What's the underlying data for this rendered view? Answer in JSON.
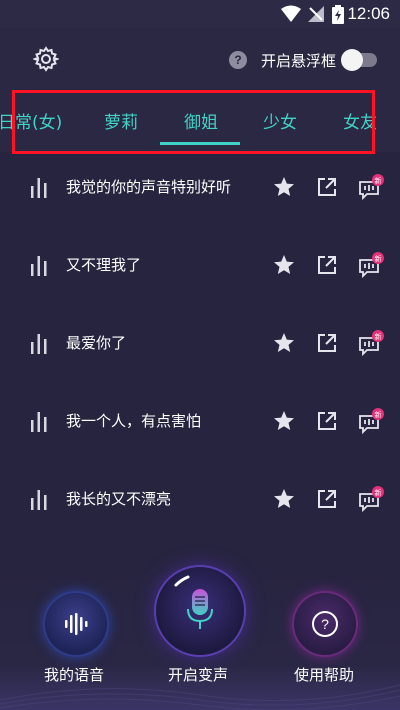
{
  "status_bar": {
    "time": "12:06"
  },
  "header": {
    "floating_window_label": "开启悬浮框",
    "floating_window_on": false
  },
  "tabs": {
    "items": [
      "日常(女)",
      "萝莉",
      "御姐",
      "少女",
      "女友"
    ],
    "selected": "御姐"
  },
  "list": {
    "items": [
      {
        "label": "我觉的你的声音特别好听",
        "badge": "新"
      },
      {
        "label": "又不理我了",
        "badge": "新"
      },
      {
        "label": "最爱你了",
        "badge": "新"
      },
      {
        "label": "我一个人，有点害怕",
        "badge": "新"
      },
      {
        "label": "我长的又不漂亮",
        "badge": "新"
      }
    ]
  },
  "bottom_nav": {
    "my_voice": "我的语音",
    "start_voice_change": "开启变声",
    "use_help": "使用帮助"
  },
  "colors": {
    "accent": "#3fd4c6",
    "background": "#27243f",
    "highlight": "#ff1426",
    "badge": "#e8307a"
  }
}
